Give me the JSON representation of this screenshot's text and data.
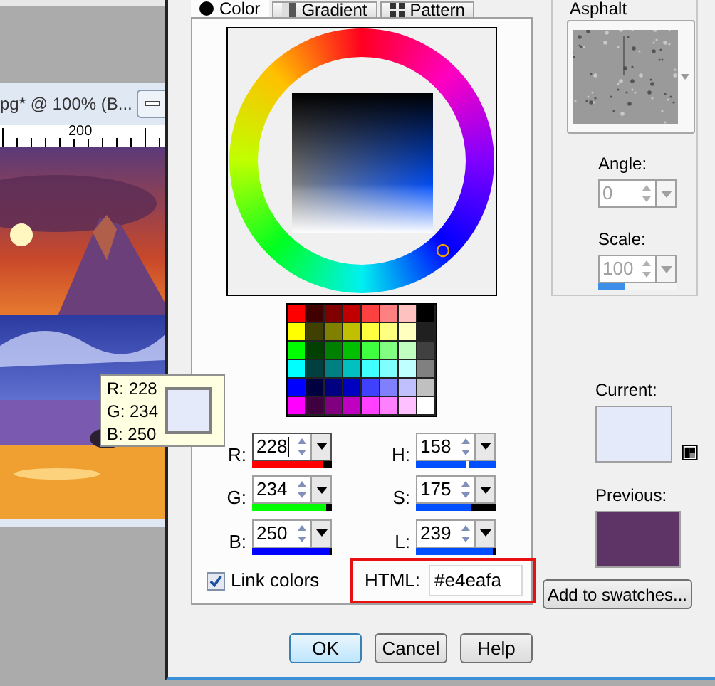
{
  "document_window": {
    "title": "pg* @ 100% (B...",
    "ruler_label": "200"
  },
  "dialog": {
    "tabs": [
      {
        "label": "Color",
        "selected": true
      },
      {
        "label": "Gradient",
        "selected": false
      },
      {
        "label": "Pattern",
        "selected": false
      }
    ],
    "palette": [
      {
        "color": "#ff0000"
      },
      {
        "color": "#400000"
      },
      {
        "color": "#800000"
      },
      {
        "color": "#c00000"
      },
      {
        "color": "#ff4040"
      },
      {
        "color": "#ff8080"
      },
      {
        "color": "#ffc0c0"
      },
      {
        "color": "#000000"
      },
      {
        "color": "#ffff00"
      },
      {
        "color": "#404000"
      },
      {
        "color": "#808000"
      },
      {
        "color": "#c0c000"
      },
      {
        "color": "#ffff40"
      },
      {
        "color": "#ffff80"
      },
      {
        "color": "#ffffc0"
      },
      {
        "color": "#202020"
      },
      {
        "color": "#00ff00"
      },
      {
        "color": "#004000"
      },
      {
        "color": "#008000"
      },
      {
        "color": "#00c000"
      },
      {
        "color": "#40ff40"
      },
      {
        "color": "#80ff80"
      },
      {
        "color": "#c0ffc0"
      },
      {
        "color": "#404040"
      },
      {
        "color": "#00ffff"
      },
      {
        "color": "#004040"
      },
      {
        "color": "#008080"
      },
      {
        "color": "#00c0c0"
      },
      {
        "color": "#40ffff"
      },
      {
        "color": "#80ffff"
      },
      {
        "color": "#c0ffff"
      },
      {
        "color": "#808080"
      },
      {
        "color": "#0000ff"
      },
      {
        "color": "#000040"
      },
      {
        "color": "#000080"
      },
      {
        "color": "#0000c0"
      },
      {
        "color": "#4040ff"
      },
      {
        "color": "#8080ff"
      },
      {
        "color": "#c0c0ff"
      },
      {
        "color": "#c0c0c0"
      },
      {
        "color": "#ff00ff"
      },
      {
        "color": "#400040"
      },
      {
        "color": "#800080"
      },
      {
        "color": "#c000c0"
      },
      {
        "color": "#ff40ff"
      },
      {
        "color": "#ff80ff"
      },
      {
        "color": "#ffc0ff"
      },
      {
        "color": "#ffffff"
      }
    ],
    "channels": [
      {
        "label": "R:",
        "value": "228",
        "focused": true,
        "kind": "fill",
        "color": "#ff0000",
        "level": 0.9
      },
      {
        "label": "H:",
        "value": "158",
        "focused": false,
        "kind": "marker",
        "color": "#0050ff",
        "level": 0.62
      },
      {
        "label": "G:",
        "value": "234",
        "focused": false,
        "kind": "fill",
        "color": "#00ff00",
        "level": 0.93
      },
      {
        "label": "S:",
        "value": "175",
        "focused": false,
        "kind": "fill",
        "color": "#0050ff",
        "level": 0.69
      },
      {
        "label": "B:",
        "value": "250",
        "focused": false,
        "kind": "fill",
        "color": "#0000ff",
        "level": 0.98
      },
      {
        "label": "L:",
        "value": "239",
        "focused": false,
        "kind": "fill",
        "color": "#0050ff",
        "level": 0.96
      }
    ],
    "link_colors": {
      "label": "Link colors",
      "checked": true
    },
    "html": {
      "label": "HTML:",
      "value": "#e4eafa",
      "highlighted": true
    },
    "buttons": [
      {
        "label": "OK",
        "default": true
      },
      {
        "label": "Cancel",
        "default": false
      },
      {
        "label": "Help",
        "default": false
      }
    ],
    "pattern": {
      "name": "Asphalt",
      "angle": {
        "label": "Angle:",
        "value": "0",
        "disabled": true
      },
      "scale": {
        "label": "Scale:",
        "value": "100",
        "disabled": true,
        "level": 0.35
      }
    },
    "current": {
      "label": "Current:",
      "color": "#e4eafa"
    },
    "previous": {
      "label": "Previous:",
      "color": "#5e3467"
    },
    "add_button": "Add to swatches..."
  },
  "tooltip": {
    "lines": [
      "R: 228",
      "G: 234",
      "B: 250"
    ],
    "color": "#e4eafa"
  }
}
